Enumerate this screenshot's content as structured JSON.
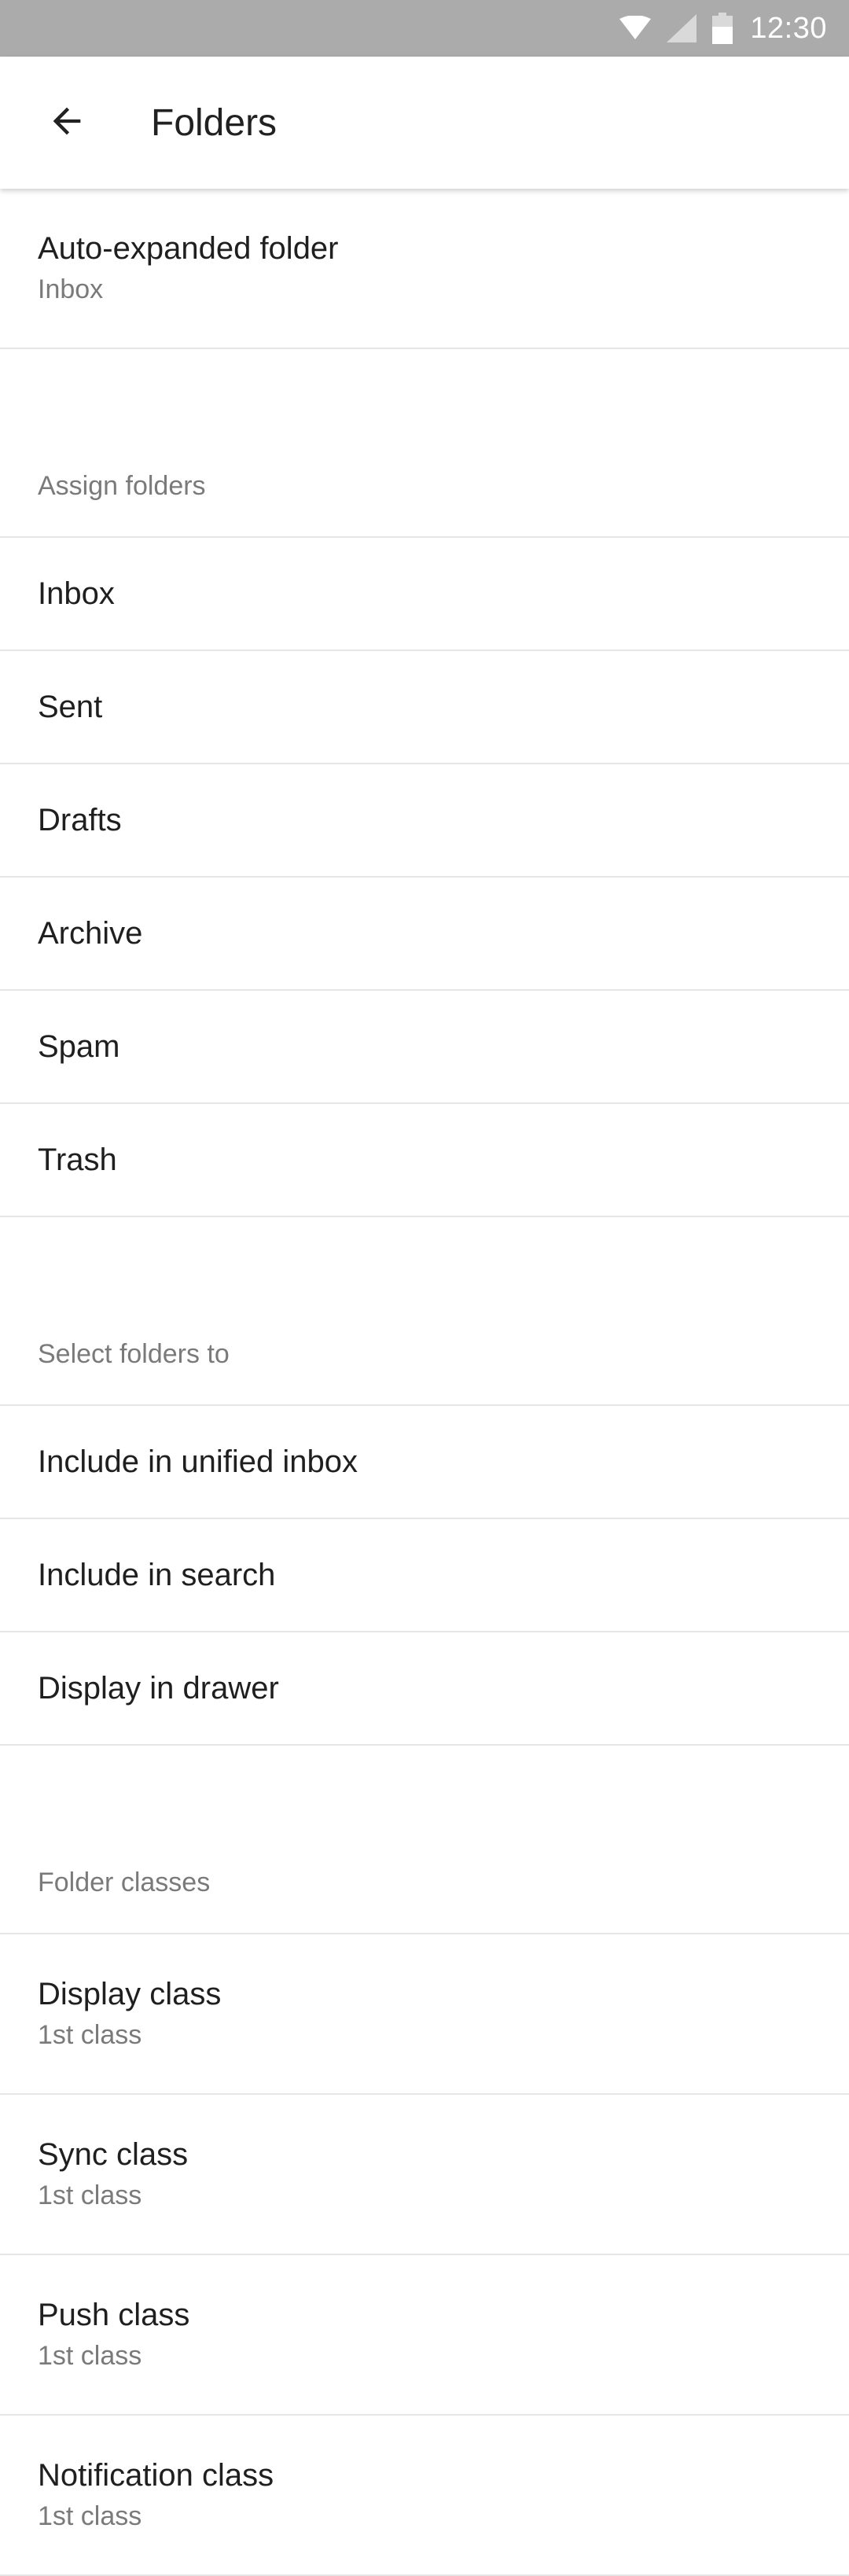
{
  "status_bar": {
    "time": "12:30",
    "icons": [
      "wifi-icon",
      "cell-signal-icon",
      "battery-icon"
    ],
    "background": "#ababab"
  },
  "app_bar": {
    "title": "Folders",
    "back_icon": "arrow-back-icon"
  },
  "auto_expanded": {
    "title": "Auto-expanded folder",
    "summary": "Inbox"
  },
  "assign_folders": {
    "header": "Assign folders",
    "items": [
      "Inbox",
      "Sent",
      "Drafts",
      "Archive",
      "Spam",
      "Trash"
    ]
  },
  "select_folders": {
    "header": "Select folders to",
    "items": [
      "Include in unified inbox",
      "Include in search",
      "Display in drawer"
    ]
  },
  "folder_classes": {
    "header": "Folder classes",
    "items": [
      {
        "title": "Display class",
        "summary": "1st class"
      },
      {
        "title": "Sync class",
        "summary": "1st class"
      },
      {
        "title": "Push class",
        "summary": "1st class"
      },
      {
        "title": "Notification class",
        "summary": "1st class"
      }
    ]
  }
}
